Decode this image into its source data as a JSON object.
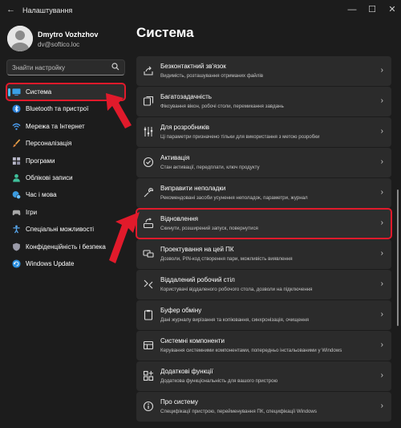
{
  "window": {
    "title": "Налаштування",
    "back_glyph": "←",
    "min_glyph": "—",
    "max_glyph": "☐",
    "close_glyph": "✕"
  },
  "user": {
    "name": "Dmytro Vozhzhov",
    "email": "dv@softico.loc"
  },
  "search": {
    "placeholder": "Знайти настройку",
    "value": ""
  },
  "sidebar": {
    "items": [
      {
        "label": "Система",
        "icon": "monitor-icon",
        "active": true
      },
      {
        "label": "Bluetooth та пристрої",
        "icon": "bluetooth-icon"
      },
      {
        "label": "Мережа та Інтернет",
        "icon": "wifi-icon"
      },
      {
        "label": "Персоналізація",
        "icon": "brush-icon"
      },
      {
        "label": "Програми",
        "icon": "apps-icon"
      },
      {
        "label": "Облікові записи",
        "icon": "person-icon"
      },
      {
        "label": "Час і мова",
        "icon": "globe-clock-icon"
      },
      {
        "label": "Ігри",
        "icon": "gamepad-icon"
      },
      {
        "label": "Спеціальні можливості",
        "icon": "accessibility-icon"
      },
      {
        "label": "Конфіденційність і безпека",
        "icon": "shield-icon"
      },
      {
        "label": "Windows Update",
        "icon": "update-icon"
      }
    ]
  },
  "main": {
    "title": "Система",
    "cards": [
      {
        "title": "Безконтактний зв'язок",
        "subtitle": "Видимість, розташування отриманих файлів",
        "icon": "share-icon"
      },
      {
        "title": "Багатозадачність",
        "subtitle": "Фіксування вікон, робочі столи, перемикання завдань",
        "icon": "multitask-icon"
      },
      {
        "title": "Для розробників",
        "subtitle": "Ці параметри призначено тільки для використання з метою розробки",
        "icon": "developer-icon"
      },
      {
        "title": "Активація",
        "subtitle": "Стан активації, передплати, ключ продукту",
        "icon": "check-circle-icon"
      },
      {
        "title": "Виправити неполадки",
        "subtitle": "Рекомендовані засоби усунення неполадок, параметри, журнал",
        "icon": "wrench-icon"
      },
      {
        "title": "Відновлення",
        "subtitle": "Скинути, розширений запуск, повернутися",
        "icon": "recovery-icon",
        "highlighted": true
      },
      {
        "title": "Проектування на цей ПК",
        "subtitle": "Дозволи, PIN-код створення пари, можливість виявлення",
        "icon": "project-icon"
      },
      {
        "title": "Віддалений робочий стіл",
        "subtitle": "Користувачі віддаленого робочого стола, дозволи на підключення",
        "icon": "remote-desktop-icon"
      },
      {
        "title": "Буфер обміну",
        "subtitle": "Дані журналу вирізання та копіювання, синхронізація, очищення",
        "icon": "clipboard-icon"
      },
      {
        "title": "Системні компоненти",
        "subtitle": "Керування системними компонентами, попередньо інстальованими у Windows",
        "icon": "components-icon"
      },
      {
        "title": "Додаткові функції",
        "subtitle": "Додаткова функціональність для вашого пристрою",
        "icon": "optional-features-icon"
      },
      {
        "title": "Про систему",
        "subtitle": "Специфікації пристрою, перейменування ПК, специфікації Windows",
        "icon": "info-icon"
      }
    ],
    "chevron": "›"
  },
  "colors": {
    "accent": "#4cc2ff",
    "highlight": "#e11a2b",
    "background": "#1c1c1c",
    "card": "#2b2b2b"
  }
}
